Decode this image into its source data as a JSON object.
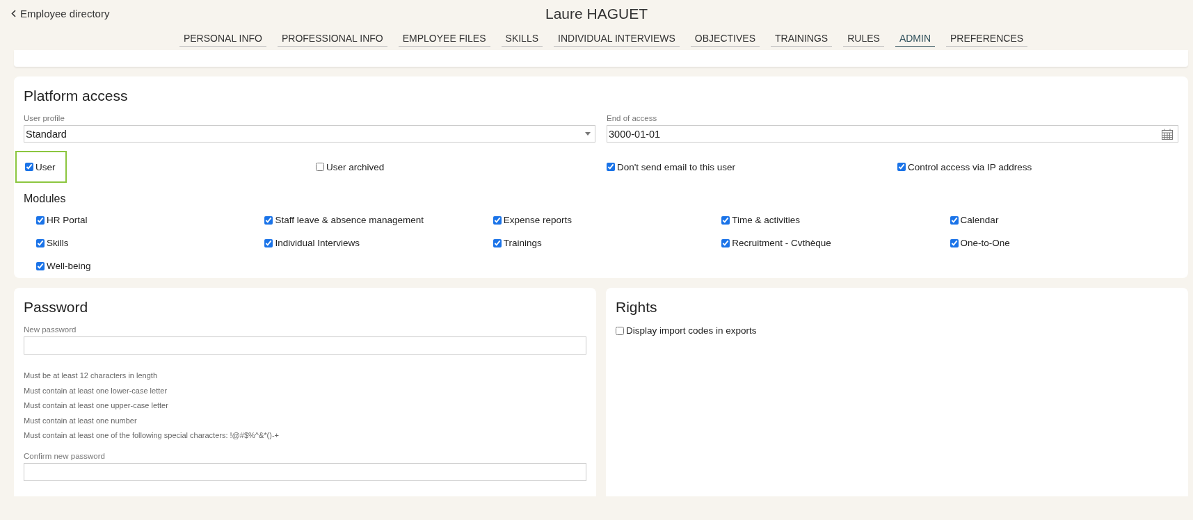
{
  "header": {
    "back_link": "Employee directory",
    "title": "Laure HAGUET"
  },
  "tabs": [
    {
      "label": "PERSONAL INFO",
      "selected": false
    },
    {
      "label": "PROFESSIONAL INFO",
      "selected": false
    },
    {
      "label": "EMPLOYEE FILES",
      "selected": false
    },
    {
      "label": "SKILLS",
      "selected": false
    },
    {
      "label": "INDIVIDUAL INTERVIEWS",
      "selected": false
    },
    {
      "label": "OBJECTIVES",
      "selected": false
    },
    {
      "label": "TRAININGS",
      "selected": false
    },
    {
      "label": "RULES",
      "selected": false
    },
    {
      "label": "ADMIN",
      "selected": true
    },
    {
      "label": "PREFERENCES",
      "selected": false
    }
  ],
  "platform_access": {
    "title": "Platform access",
    "user_profile": {
      "label": "User profile",
      "value": "Standard"
    },
    "end_of_access": {
      "label": "End of access",
      "value": "3000-01-01"
    },
    "options": [
      {
        "label": "User",
        "checked": true,
        "highlighted": true
      },
      {
        "label": "User archived",
        "checked": false,
        "highlighted": false
      },
      {
        "label": "Don't send email to this user",
        "checked": true,
        "highlighted": false
      },
      {
        "label": "Control access via IP address",
        "checked": true,
        "highlighted": false
      }
    ],
    "modules_title": "Modules",
    "modules": [
      {
        "label": "HR Portal",
        "checked": true
      },
      {
        "label": "Staff leave & absence management",
        "checked": true
      },
      {
        "label": "Expense reports",
        "checked": true
      },
      {
        "label": "Time & activities",
        "checked": true
      },
      {
        "label": "Calendar",
        "checked": true
      },
      {
        "label": "Skills",
        "checked": true
      },
      {
        "label": "Individual Interviews",
        "checked": true
      },
      {
        "label": "Trainings",
        "checked": true
      },
      {
        "label": "Recruitment - Cvthèque",
        "checked": true
      },
      {
        "label": "One-to-One",
        "checked": true
      },
      {
        "label": "Well-being",
        "checked": true
      }
    ]
  },
  "password": {
    "title": "Password",
    "new_label": "New password",
    "rules": [
      "Must be at least 12 characters in length",
      "Must contain at least one lower-case letter",
      "Must contain at least one upper-case letter",
      "Must contain at least one number",
      "Must contain at least one of the following special characters: !@#$%^&*()-+"
    ],
    "confirm_label": "Confirm new password"
  },
  "rights": {
    "title": "Rights",
    "options": [
      {
        "label": "Display import codes in exports",
        "checked": false
      }
    ]
  }
}
